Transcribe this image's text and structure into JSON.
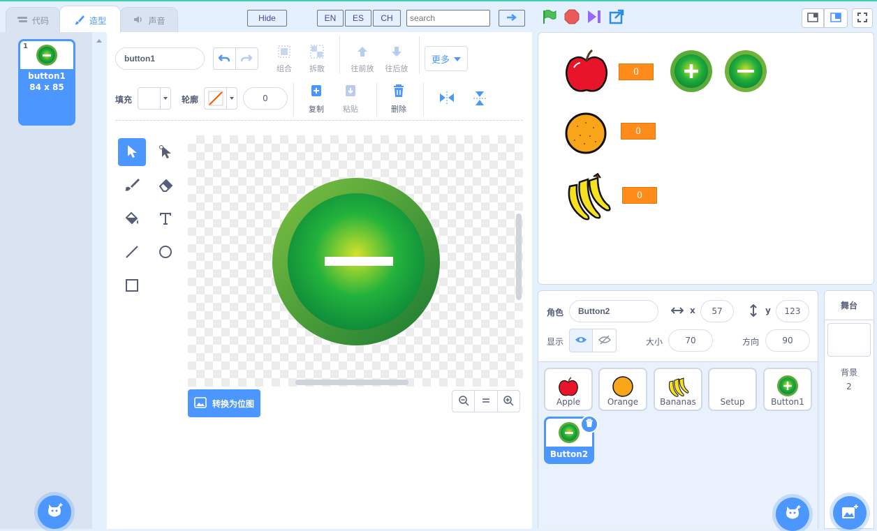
{
  "tabs": {
    "code": "代码",
    "costumes": "造型",
    "sounds": "声音"
  },
  "toolbar": {
    "hide": "Hide",
    "en": "EN",
    "es": "ES",
    "ch": "CH",
    "search_placeholder": "search"
  },
  "costume_list": {
    "index": "1",
    "name": "button1",
    "size": "84 x 85"
  },
  "editor": {
    "costume_name": "button1",
    "group": "组合",
    "ungroup": "拆散",
    "forward": "往前放",
    "backward": "往后放",
    "more": "更多",
    "fill_label": "填充",
    "outline_label": "轮廓",
    "outline_width": "0",
    "copy": "复制",
    "paste": "粘贴",
    "delete": "删除",
    "convert_bitmap": "转换为位图"
  },
  "stage": {
    "counters": [
      {
        "value": "0"
      },
      {
        "value": "0"
      },
      {
        "value": "0"
      }
    ]
  },
  "sprite_info": {
    "sprite_label": "角色",
    "sprite_name": "Button2",
    "x_label": "x",
    "x": "57",
    "y_label": "y",
    "y": "123",
    "show_label": "显示",
    "size_label": "大小",
    "size": "70",
    "direction_label": "方向",
    "direction": "90"
  },
  "sprites": [
    {
      "name": "Apple"
    },
    {
      "name": "Orange"
    },
    {
      "name": "Bananas"
    },
    {
      "name": "Setup"
    },
    {
      "name": "Button1"
    },
    {
      "name": "Button2"
    }
  ],
  "stage_panel": {
    "title": "舞台",
    "backdrop_label": "背景",
    "backdrop_count": "2"
  },
  "colors": {
    "accent": "#4c97ff",
    "counter": "#ff8c1a",
    "button_green": "#2aa43a"
  }
}
